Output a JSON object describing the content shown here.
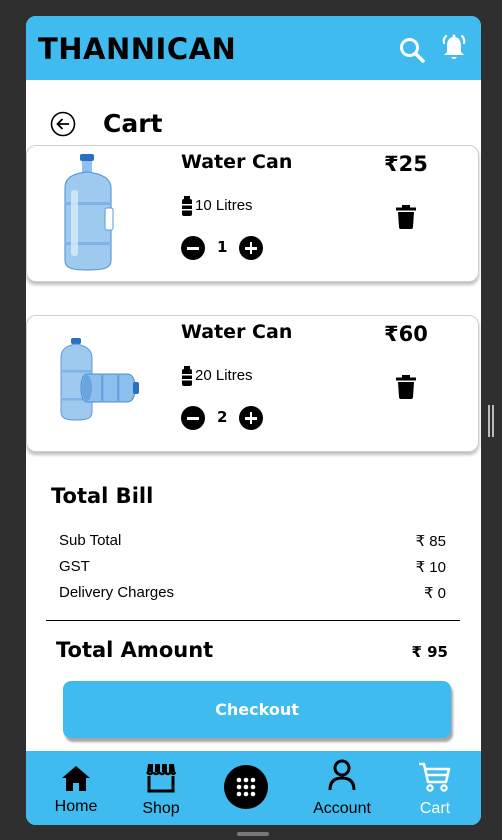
{
  "app": {
    "brand": "THANNICAN"
  },
  "header": {
    "search_icon": "search-icon",
    "bell_icon": "bell-icon"
  },
  "page": {
    "title": "Cart",
    "back_icon": "back-arrow-icon"
  },
  "cart": {
    "items": [
      {
        "name": "Water Can",
        "price": "₹25",
        "volume": "10 Litres",
        "quantity": "1"
      },
      {
        "name": "Water Can",
        "price": "₹60",
        "volume": " 20 Litres",
        "quantity": "2"
      }
    ]
  },
  "bill": {
    "title": "Total Bill",
    "rows": [
      {
        "label": "Sub Total",
        "value": "₹ 85"
      },
      {
        "label": "GST",
        "value": "₹ 10"
      },
      {
        "label": "Delivery Charges",
        "value": "₹ 0"
      }
    ],
    "total_label": "Total Amount",
    "total_value": "₹ 95"
  },
  "checkout": {
    "label": "Checkout"
  },
  "nav": {
    "items": [
      {
        "label": "Home",
        "icon": "home-icon"
      },
      {
        "label": "Shop",
        "icon": "store-icon"
      },
      {
        "label": "",
        "icon": "grid-dots-icon"
      },
      {
        "label": "Account",
        "icon": "account-icon"
      },
      {
        "label": "Cart",
        "icon": "cart-icon"
      }
    ]
  },
  "colors": {
    "accent": "#3fbbef",
    "background": "#2f2f2f",
    "card": "#ffffff"
  }
}
